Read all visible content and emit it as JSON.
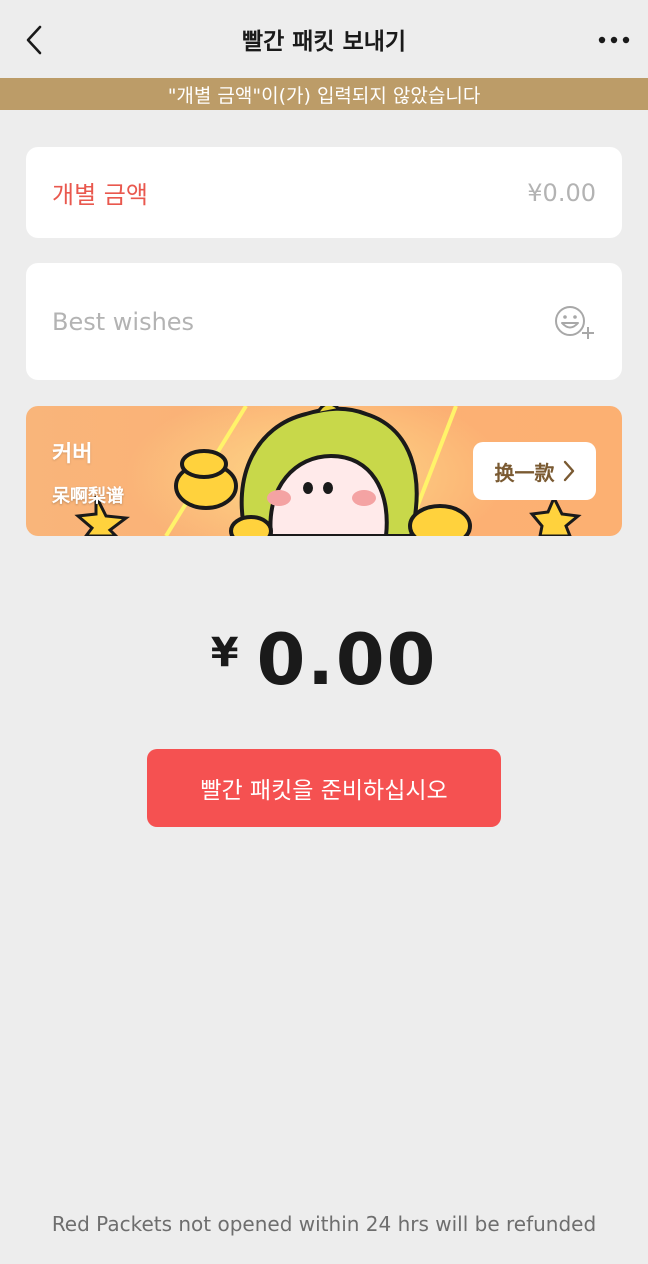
{
  "header": {
    "title": "빨간 패킷 보내기",
    "back_icon": "chevron-left-icon",
    "more_icon": "more-dots-icon"
  },
  "warning": {
    "text": "\"개별 금액\"이(가) 입력되지 않았습니다",
    "color": "#bc9c68"
  },
  "amount": {
    "label": "개별 금액",
    "value": "¥0.00",
    "label_color": "#e9584e"
  },
  "wishes": {
    "placeholder": "Best wishes",
    "emoji_icon": "emoji-add-icon"
  },
  "cover": {
    "label": "커버",
    "name": "呆啊梨谱",
    "change_label": "换一款",
    "change_icon": "chevron-right-icon"
  },
  "total": {
    "currency": "¥",
    "value": "0.00"
  },
  "submit": {
    "label": "빨간 패킷을 준비하십시오",
    "color": "#f55151"
  },
  "footer": {
    "note": "Red Packets not opened within 24 hrs will be refunded"
  }
}
